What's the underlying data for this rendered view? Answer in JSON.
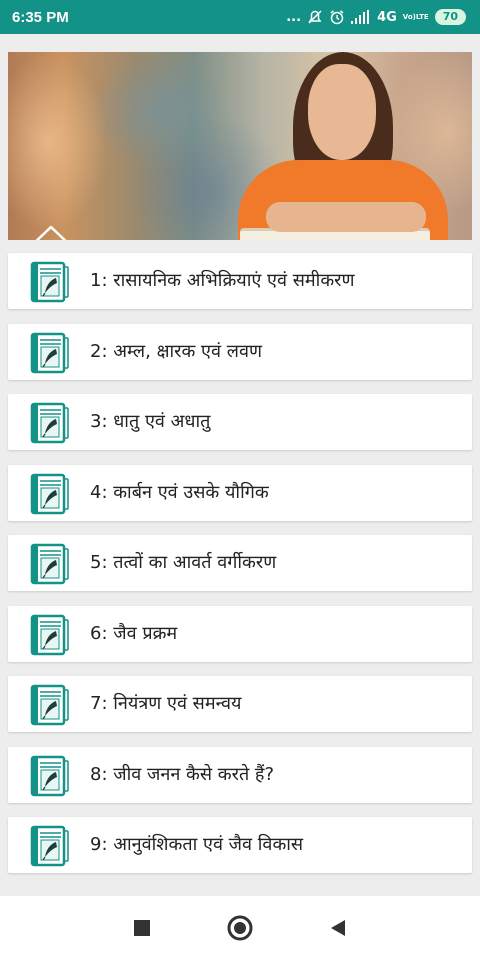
{
  "status_bar": {
    "time": "6:35 PM",
    "dots": "...",
    "network": "4G",
    "volte_top": "Vo)",
    "volte_bottom": "LTE",
    "battery": "70"
  },
  "banner": {
    "icon": "home-icon"
  },
  "chapters": [
    {
      "label": "1: रासायनिक अभिक्रियाएं एवं समीकरण",
      "icon": "book-icon"
    },
    {
      "label": "2: अम्ल, क्षारक एवं लवण",
      "icon": "book-icon"
    },
    {
      "label": "3: धातु एवं अधातु",
      "icon": "book-icon"
    },
    {
      "label": "4: कार्बन एवं उसके यौगिक",
      "icon": "book-icon"
    },
    {
      "label": "5: तत्वों का आवर्त वर्गीकरण",
      "icon": "book-icon"
    },
    {
      "label": "6: जैव प्रक्रम",
      "icon": "book-icon"
    },
    {
      "label": "7: नियंत्रण एवं समन्वय",
      "icon": "book-icon"
    },
    {
      "label": "8: जीव जनन कैसे करते हैं?",
      "icon": "book-icon"
    },
    {
      "label": "9: आनुवंशिकता एवं जैव विकास",
      "icon": "book-icon"
    }
  ],
  "nav": {
    "recents": "square-icon",
    "home": "circle-icon",
    "back": "triangle-back-icon"
  },
  "colors": {
    "status_bar": "#139287",
    "icon_teal": "#139287",
    "card_bg": "#ffffff",
    "page_bg": "#ededed"
  }
}
